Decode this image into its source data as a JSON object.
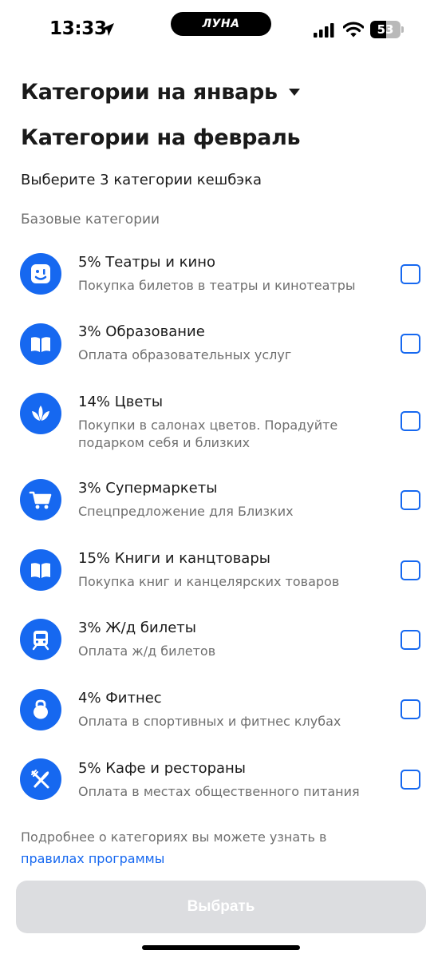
{
  "status_bar": {
    "time": "13:33",
    "island_logo": "ЛУНА",
    "battery_level": "53",
    "icons": [
      "location-arrow-icon",
      "signal-icon",
      "wifi-icon",
      "battery-icon"
    ]
  },
  "header": {
    "month_selector": "Категории на январь",
    "title": "Категории на февраль",
    "subtitle": "Выберите 3 категории кешбэка",
    "section_label": "Базовые категории"
  },
  "categories": [
    {
      "title": "5% Театры и кино",
      "description": "Покупка билетов в театры и кинотеатры",
      "icon": "smile-face-icon",
      "checked": false
    },
    {
      "title": "3% Образование",
      "description": "Оплата образовательных услуг",
      "icon": "open-book-icon",
      "checked": false
    },
    {
      "title": "14% Цветы",
      "description": "Покупки в салонах цветов. Порадуйте подарком себя и близких",
      "icon": "lotus-flower-icon",
      "checked": false
    },
    {
      "title": "3% Супермаркеты",
      "description": "Спецпредложение для Близких",
      "icon": "shopping-cart-icon",
      "checked": false
    },
    {
      "title": "15% Книги и канцтовары",
      "description": "Покупка книг и канцелярских товаров",
      "icon": "open-book-icon",
      "checked": false
    },
    {
      "title": "3% Ж/д билеты",
      "description": "Оплата ж/д билетов",
      "icon": "train-icon",
      "checked": false
    },
    {
      "title": "4% Фитнес",
      "description": "Оплата в спортивных и фитнес клубах",
      "icon": "kettlebell-icon",
      "checked": false
    },
    {
      "title": "5% Кафе и рестораны",
      "description": "Оплата в местах общественного питания",
      "icon": "fork-knife-icon",
      "checked": false
    }
  ],
  "footer": {
    "note": "Подробнее о категориях вы можете узнать в",
    "link": "правилах программы",
    "button": "Выбрать"
  },
  "colors": {
    "accent": "#1668f0",
    "button_disabled": "#dcdde0",
    "secondary_text": "#6f6f6f"
  }
}
